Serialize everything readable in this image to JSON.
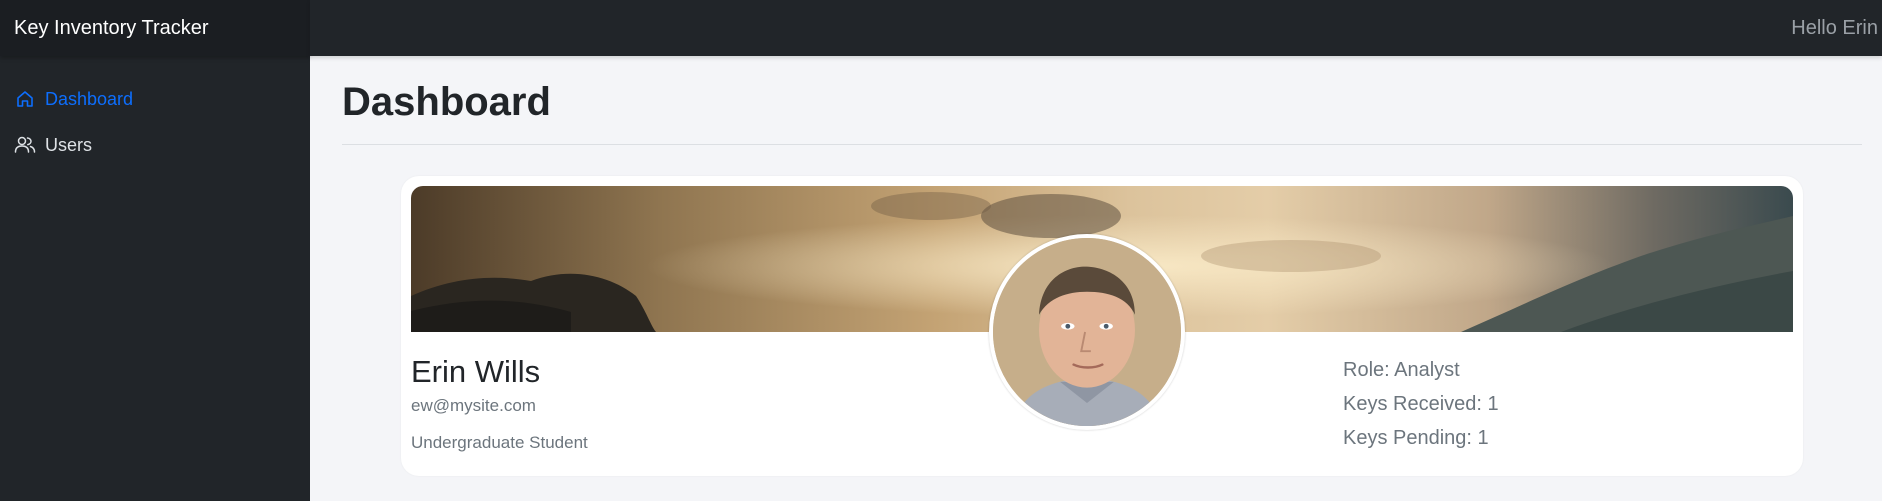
{
  "app": {
    "title": "Key Inventory Tracker"
  },
  "header": {
    "greeting": "Hello Erin"
  },
  "sidebar": {
    "items": [
      {
        "label": "Dashboard",
        "icon": "home-icon",
        "active": true
      },
      {
        "label": "Users",
        "icon": "users-icon",
        "active": false
      }
    ]
  },
  "main": {
    "title": "Dashboard",
    "profile": {
      "name": "Erin Wills",
      "email": "ew@mysite.com",
      "title": "Undergraduate Student",
      "role": "Role: Analyst",
      "keys_received": "Keys Received: 1",
      "keys_pending": "Keys Pending: 1"
    }
  },
  "colors": {
    "accent": "#0d6efd",
    "sidebar_bg": "#212529",
    "page_bg": "#f4f5f8"
  }
}
